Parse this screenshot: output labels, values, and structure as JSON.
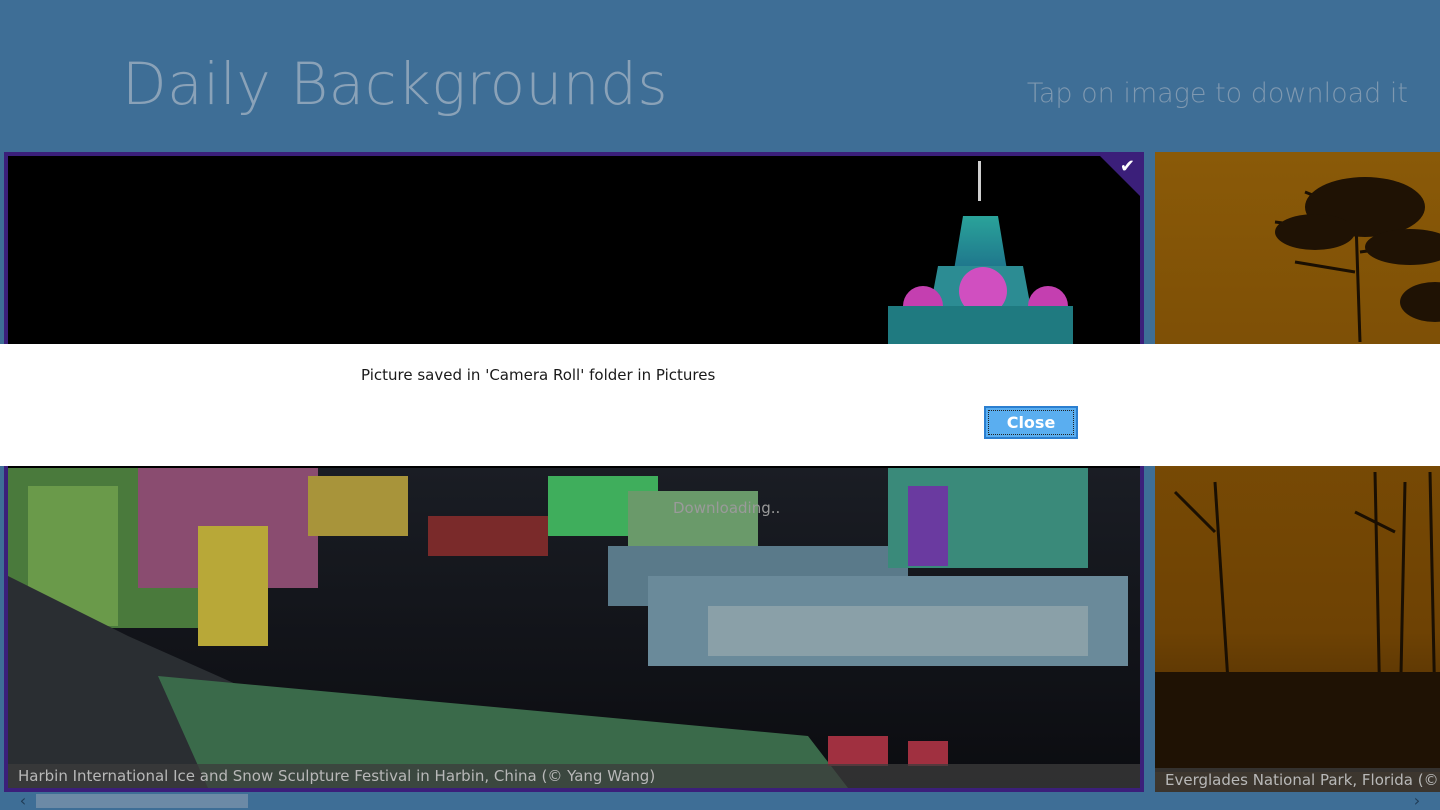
{
  "app": {
    "title": "Daily Backgrounds",
    "hint": "Tap on image to download it"
  },
  "tiles": [
    {
      "caption": "Harbin International Ice and Snow Sculpture Festival in Harbin, China (© Yang Wang)",
      "status": "Downloading..",
      "selected": true,
      "check_icon": "✔"
    },
    {
      "caption": "Everglades National Park, Florida (© Ange"
    }
  ],
  "dialog": {
    "message": "Picture saved in 'Camera Roll' folder in Pictures",
    "close_label": "Close"
  },
  "scrollbar": {
    "left_arrow": "‹",
    "right_arrow": "›"
  },
  "colors": {
    "background": "#3e6e96",
    "selection_border": "#3b1f7a",
    "button": "#5aaef0"
  }
}
